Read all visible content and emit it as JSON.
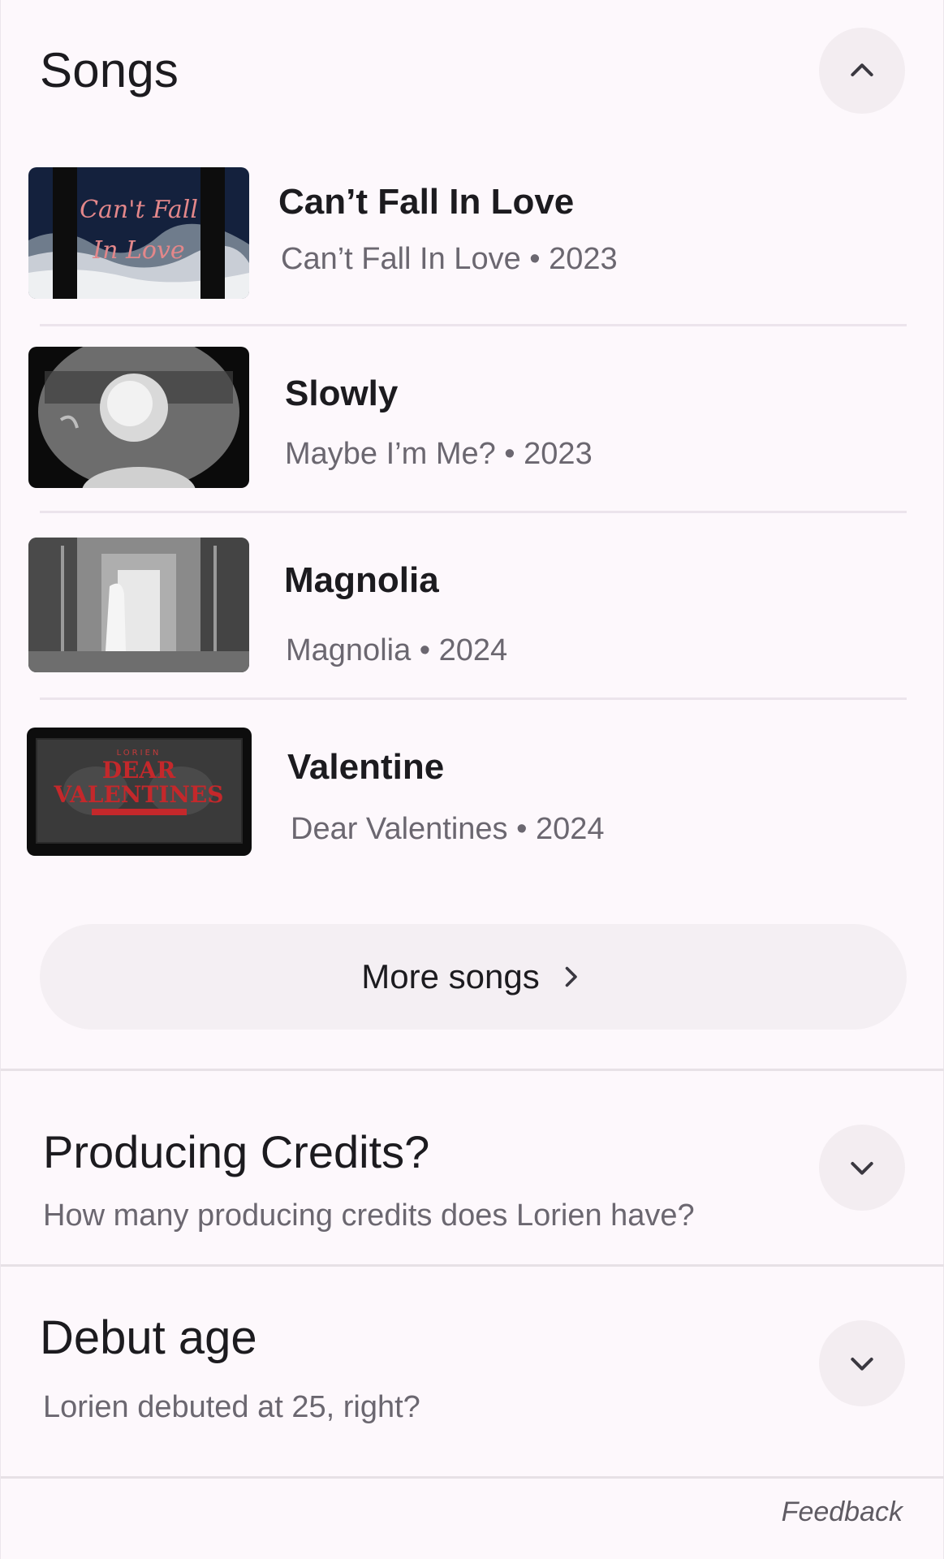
{
  "songs_section": {
    "title": "Songs",
    "collapse_icon": "chevron-up-icon",
    "items": [
      {
        "title": "Can’t Fall In Love",
        "subtitle": "Can’t Fall In Love • 2023",
        "thumb_text_1": "Can't Fall",
        "thumb_text_2": "In Love"
      },
      {
        "title": "Slowly",
        "subtitle": "Maybe I’m Me? • 2023"
      },
      {
        "title": "Magnolia",
        "subtitle": "Magnolia • 2024"
      },
      {
        "title": "Valentine",
        "subtitle": "Dear Valentines • 2024",
        "thumb_text_top": "LORIEN",
        "thumb_text_1": "DEAR",
        "thumb_text_2": "VALENTINES"
      }
    ],
    "more_button": {
      "label": "More songs",
      "icon": "chevron-right-icon"
    }
  },
  "faq": [
    {
      "title": "Producing Credits?",
      "subtitle": "How many producing credits does Lorien have?",
      "icon": "chevron-down-icon"
    },
    {
      "title": "Debut age",
      "subtitle": "Lorien debuted at 25, right?",
      "icon": "chevron-down-icon"
    }
  ],
  "footer": {
    "feedback_label": "Feedback"
  },
  "colors": {
    "background": "#fdf8fc",
    "button_bg": "#f3edf1",
    "subtitle": "#6b6770",
    "divider": "#ece4ec"
  }
}
